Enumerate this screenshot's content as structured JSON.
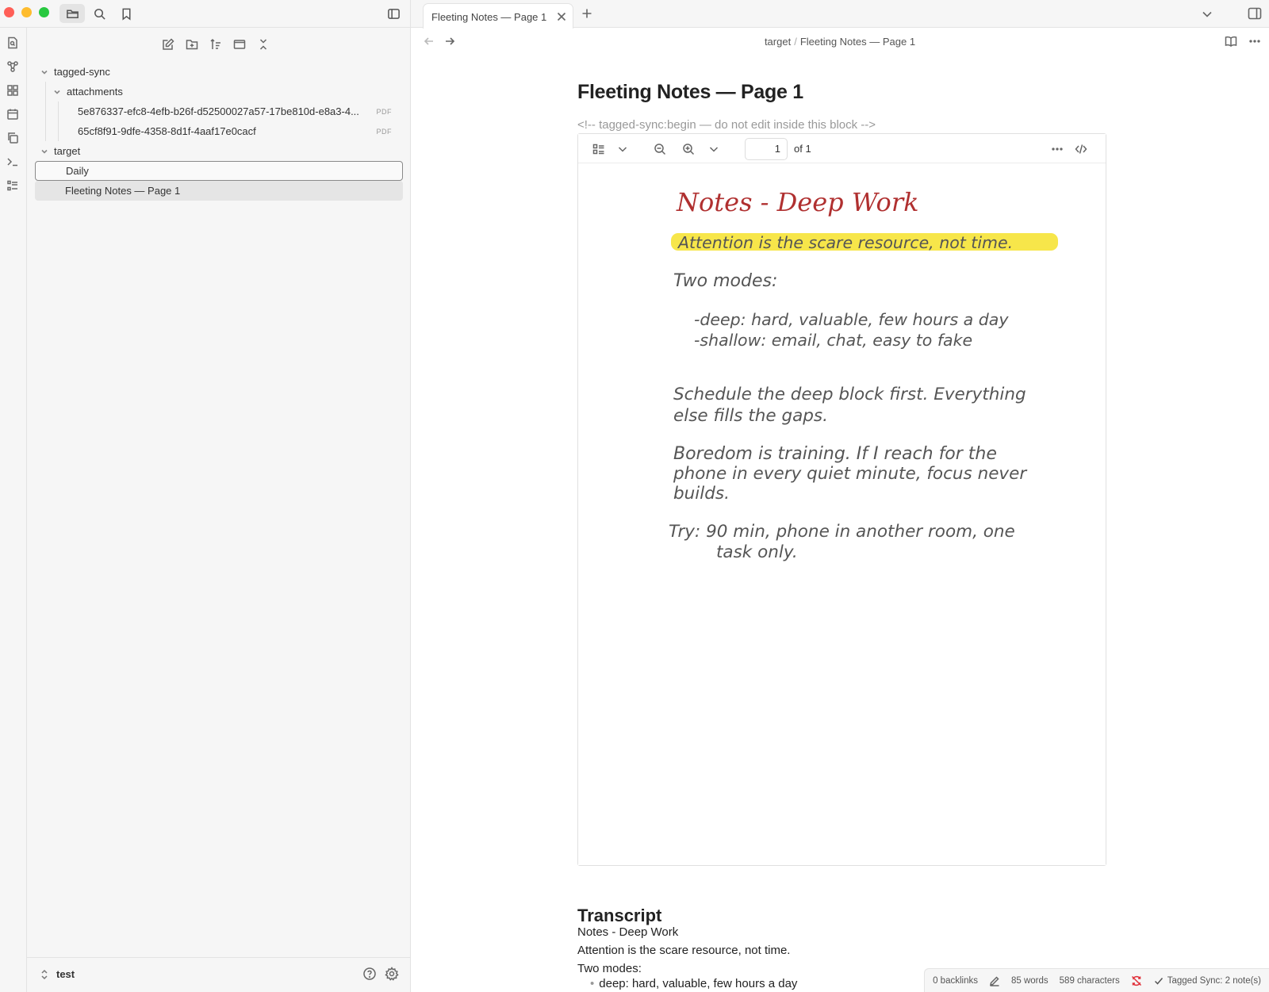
{
  "sidebar": {
    "tree": {
      "root_folder": "tagged-sync",
      "attachments_folder": "attachments",
      "attachment_1": "5e876337-efc8-4efb-b26f-d52500027a57-17be810d-e8a3-4...",
      "attachment_2": "65cf8f91-9dfe-4358-8d1f-4aaf17e0cacf",
      "file_type_tag": "PDF",
      "target_folder": "target",
      "daily": "Daily",
      "fleeting": "Fleeting Notes — Page 1"
    },
    "vault_name": "test"
  },
  "tab": {
    "title": "Fleeting Notes — Page 1"
  },
  "breadcrumb": {
    "folder": "target",
    "separator": "/",
    "file": "Fleeting Notes — Page 1"
  },
  "note": {
    "title": "Fleeting Notes — Page 1",
    "sync_comment": "<!-- tagged-sync:begin — do not edit inside this block -->"
  },
  "pdf": {
    "page_current": "1",
    "page_total": "of 1",
    "handwriting": {
      "title": "Notes - Deep Work",
      "highlight": "Attention is the scare resource, not time.",
      "modes_label": "Two modes:",
      "mode_deep": "-deep: hard, valuable, few hours a day",
      "mode_shallow": "-shallow: email, chat, easy to fake",
      "para1_line1": "Schedule the deep block first. Everything",
      "para1_line2": "else fills the gaps.",
      "para2_line1": "Boredom is training. If I reach for the",
      "para2_line2": "phone in every quiet minute, focus never",
      "para2_line3": "builds.",
      "try_line1": "Try: 90 min, phone in another room, one",
      "try_line2": "task only."
    },
    "colors": {
      "title": "#b03030",
      "highlight": "#f7e64a",
      "ink": "#555555"
    }
  },
  "transcript": {
    "heading": "Transcript",
    "line1": "Notes - Deep Work",
    "line2": "Attention is the scare resource, not time.",
    "line3": "Two modes:",
    "bullet1": "deep: hard, valuable, few hours a day"
  },
  "statusbar": {
    "backlinks": "0 backlinks",
    "words": "85 words",
    "characters": "589 characters",
    "sync_status": "Tagged Sync: 2 note(s)"
  }
}
